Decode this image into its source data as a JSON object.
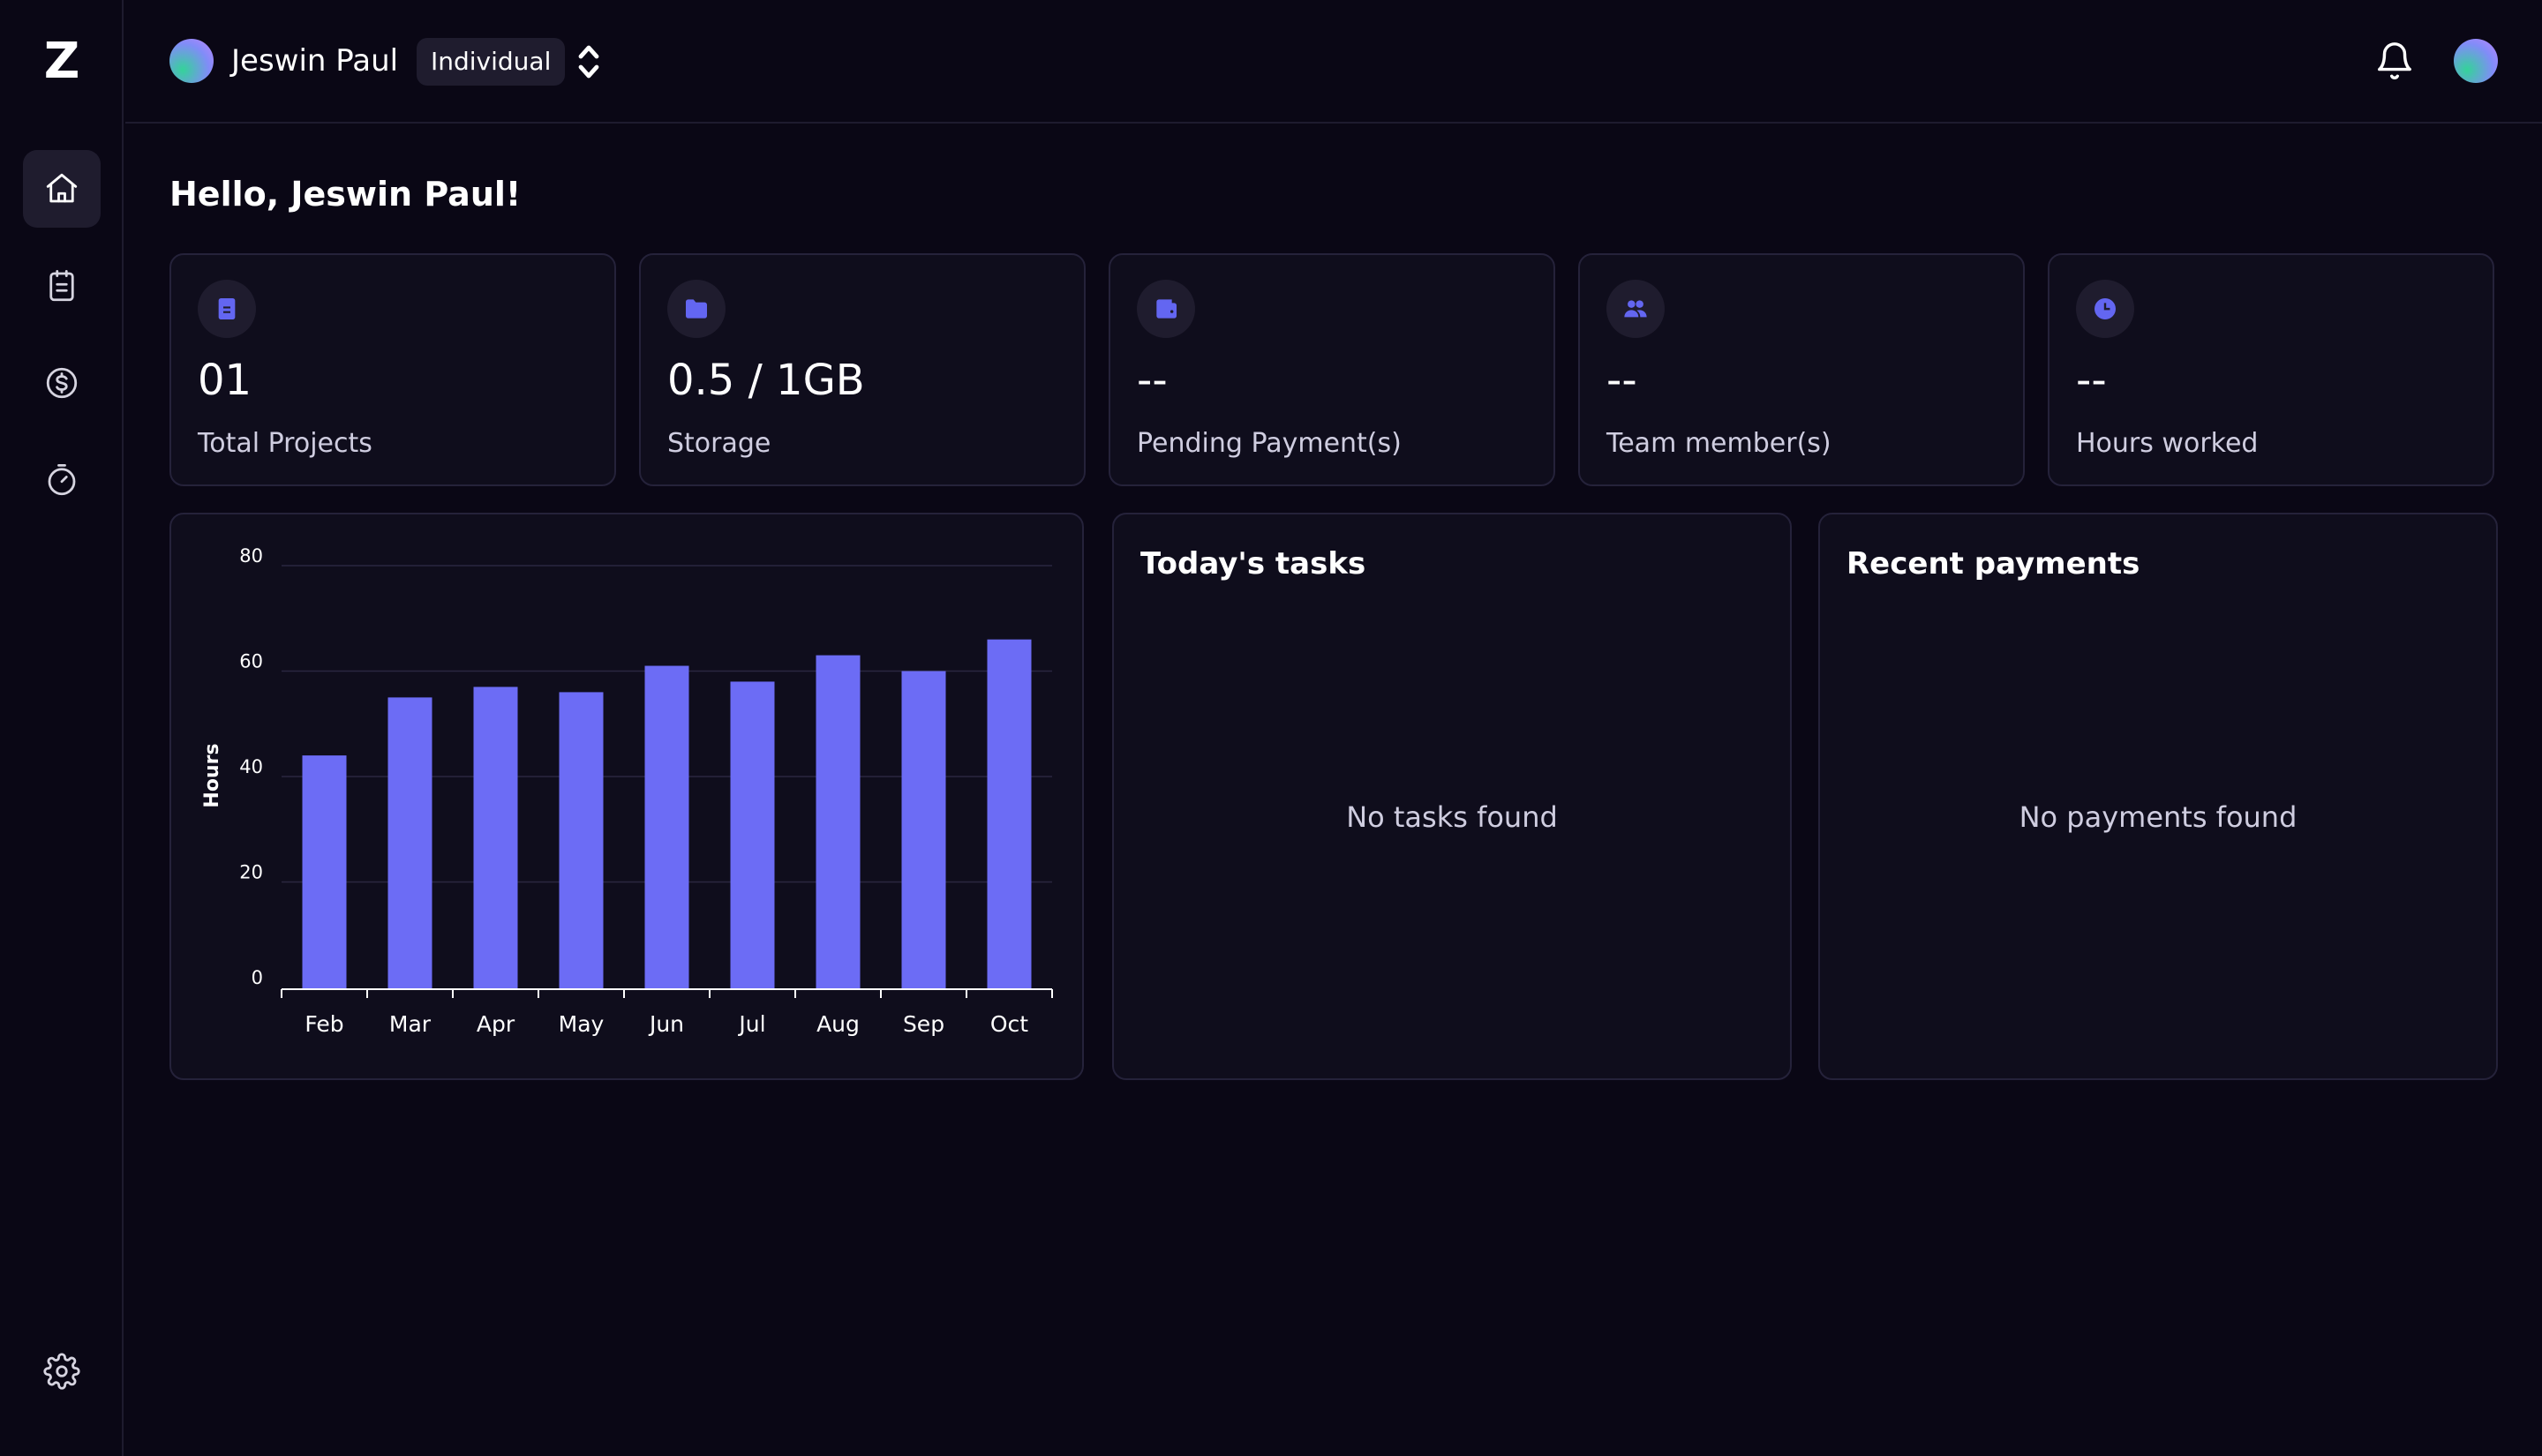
{
  "app": {
    "logo": "Z"
  },
  "sidebar": {
    "items": [
      {
        "icon": "home-icon",
        "active": true
      },
      {
        "icon": "clipboard-icon",
        "active": false
      },
      {
        "icon": "dollar-icon",
        "active": false
      },
      {
        "icon": "stopwatch-icon",
        "active": false
      }
    ],
    "settings_icon": "gear-icon"
  },
  "header": {
    "user_name": "Jeswin Paul",
    "account_type": "Individual",
    "switch_icon": "chevron-up-down-icon",
    "bell_icon": "bell-icon"
  },
  "greeting": "Hello, Jeswin Paul!",
  "stats": [
    {
      "icon": "clipboard-icon",
      "value": "01",
      "label": "Total Projects"
    },
    {
      "icon": "folder-icon",
      "value": "0.5 / 1GB",
      "label": "Storage"
    },
    {
      "icon": "wallet-icon",
      "value": "--",
      "label": "Pending Payment(s)"
    },
    {
      "icon": "users-icon",
      "value": "--",
      "label": "Team member(s)"
    },
    {
      "icon": "clock-icon",
      "value": "--",
      "label": "Hours worked"
    }
  ],
  "tasks": {
    "title": "Today's tasks",
    "empty": "No tasks found"
  },
  "payments": {
    "title": "Recent payments",
    "empty": "No payments found"
  },
  "colors": {
    "accent": "#6366f1",
    "bar": "#6c6cf5",
    "background": "#0a0715",
    "card": "#0f0d1c"
  },
  "chart_data": {
    "type": "bar",
    "categories": [
      "Feb",
      "Mar",
      "Apr",
      "May",
      "Jun",
      "Jul",
      "Aug",
      "Sep",
      "Oct"
    ],
    "values": [
      44,
      55,
      57,
      56,
      61,
      58,
      63,
      60,
      66
    ],
    "title": "",
    "xlabel": "",
    "ylabel": "Hours",
    "ylim": [
      0,
      80
    ],
    "yticks": [
      0,
      20,
      40,
      60,
      80
    ],
    "grid": true,
    "legend": "none"
  }
}
